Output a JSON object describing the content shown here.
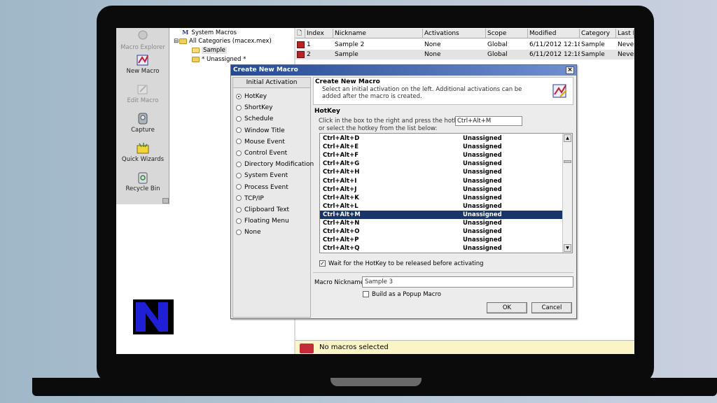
{
  "toolbar": {
    "macro_explorer": "Macro Explorer",
    "new_macro": "New Macro",
    "edit_macro": "Edit Macro",
    "capture": "Capture",
    "quick_wizards": "Quick Wizards",
    "recycle_bin": "Recycle Bin"
  },
  "tree": {
    "system_macros": "System Macros",
    "all_categories": "All Categories (macex.mex)",
    "sample": "Sample",
    "unassigned": "* Unassigned *"
  },
  "list": {
    "columns": [
      "Index",
      "Nickname",
      "Activations",
      "Scope",
      "Modified",
      "Category",
      "Last R"
    ],
    "rows": [
      [
        "1",
        "Sample 2",
        "None",
        "Global",
        "6/11/2012 12:18:1",
        "Sample",
        "Never"
      ],
      [
        "2",
        "Sample",
        "None",
        "Global",
        "6/11/2012 12:18:1",
        "Sample",
        "Never"
      ]
    ]
  },
  "status": {
    "text": "No macros selected"
  },
  "dialog": {
    "title": "Create New Macro",
    "close": "×",
    "initial_activation": "Initial Activation",
    "activations": [
      {
        "label": "HotKey",
        "selected": true
      },
      {
        "label": "ShortKey",
        "selected": false
      },
      {
        "label": "Schedule",
        "selected": false
      },
      {
        "label": "Window Title",
        "selected": false
      },
      {
        "label": "Mouse Event",
        "selected": false
      },
      {
        "label": "Control Event",
        "selected": false
      },
      {
        "label": "Directory Modification",
        "selected": false
      },
      {
        "label": "System Event",
        "selected": false
      },
      {
        "label": "Process Event",
        "selected": false
      },
      {
        "label": "TCP/IP",
        "selected": false
      },
      {
        "label": "Clipboard Text",
        "selected": false
      },
      {
        "label": "Floating Menu",
        "selected": false
      },
      {
        "label": "None",
        "selected": false
      }
    ],
    "header_title": "Create New Macro",
    "header_desc": "Select an initial activation on the left.  Additional activations can be added after the macro is created.",
    "hotkey_label": "HotKey",
    "hotkey_instruction1": "Click in the box to the right and press the hotkey:",
    "hotkey_instruction2": "or select the hotkey from the list below:",
    "hotkey_value": "Ctrl+Alt+M",
    "hotkeys": [
      [
        "Ctrl+Alt+D",
        "Unassigned"
      ],
      [
        "Ctrl+Alt+E",
        "Unassigned"
      ],
      [
        "Ctrl+Alt+F",
        "Unassigned"
      ],
      [
        "Ctrl+Alt+G",
        "Unassigned"
      ],
      [
        "Ctrl+Alt+H",
        "Unassigned"
      ],
      [
        "Ctrl+Alt+I",
        "Unassigned"
      ],
      [
        "Ctrl+Alt+J",
        "Unassigned"
      ],
      [
        "Ctrl+Alt+K",
        "Unassigned"
      ],
      [
        "Ctrl+Alt+L",
        "Unassigned"
      ],
      [
        "Ctrl+Alt+M",
        "Unassigned"
      ],
      [
        "Ctrl+Alt+N",
        "Unassigned"
      ],
      [
        "Ctrl+Alt+O",
        "Unassigned"
      ],
      [
        "Ctrl+Alt+P",
        "Unassigned"
      ],
      [
        "Ctrl+Alt+Q",
        "Unassigned"
      ]
    ],
    "selected_hotkey_index": 9,
    "wait_label": "Wait for the HotKey to be released before activating",
    "wait_checked": true,
    "nickname_label": "Macro Nickname:",
    "nickname_value": "Sample 3",
    "popup_label": "Build as a Popup Macro",
    "popup_checked": false,
    "ok": "OK",
    "cancel": "Cancel"
  },
  "colors": {
    "title_gradient_start": "#254a94",
    "selection": "#183569",
    "logo_blue": "#1f1fd6"
  }
}
